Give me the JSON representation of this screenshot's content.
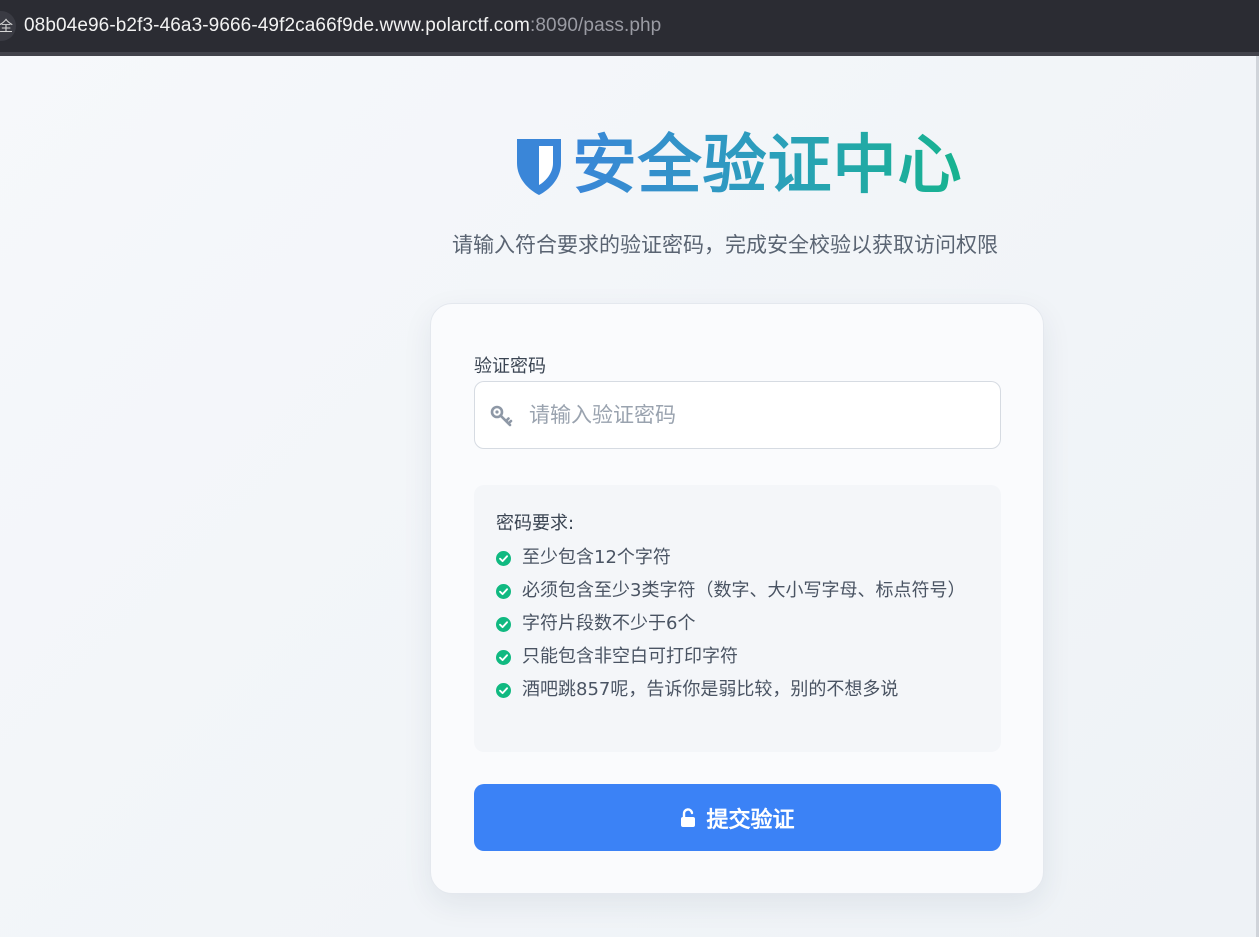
{
  "browser": {
    "url_host": "08b04e96-b2f3-46a3-9666-49f2ca66f9de.www.polarctf.com",
    "url_rest": ":8090/pass.php",
    "security_glyph": "全"
  },
  "header": {
    "title": "安全验证中心",
    "subtitle": "请输入符合要求的验证密码，完成安全校验以获取访问权限",
    "icon": "shield-icon"
  },
  "form": {
    "password_label": "验证密码",
    "password_placeholder": "请输入验证密码",
    "password_value": "",
    "input_icon": "key-icon"
  },
  "requirements": {
    "title": "密码要求:",
    "items": [
      "至少包含12个字符",
      "必须包含至少3类字符（数字、大小写字母、标点符号）",
      "字符片段数不少于6个",
      "只能包含非空白可打印字符",
      "酒吧跳857呢，告诉你是弱比较，别的不想多说"
    ],
    "item_icon": "check-circle-icon",
    "check_color": "#10b981"
  },
  "submit": {
    "label": "提交验证",
    "icon": "unlock-icon",
    "color": "#3b82f6"
  }
}
